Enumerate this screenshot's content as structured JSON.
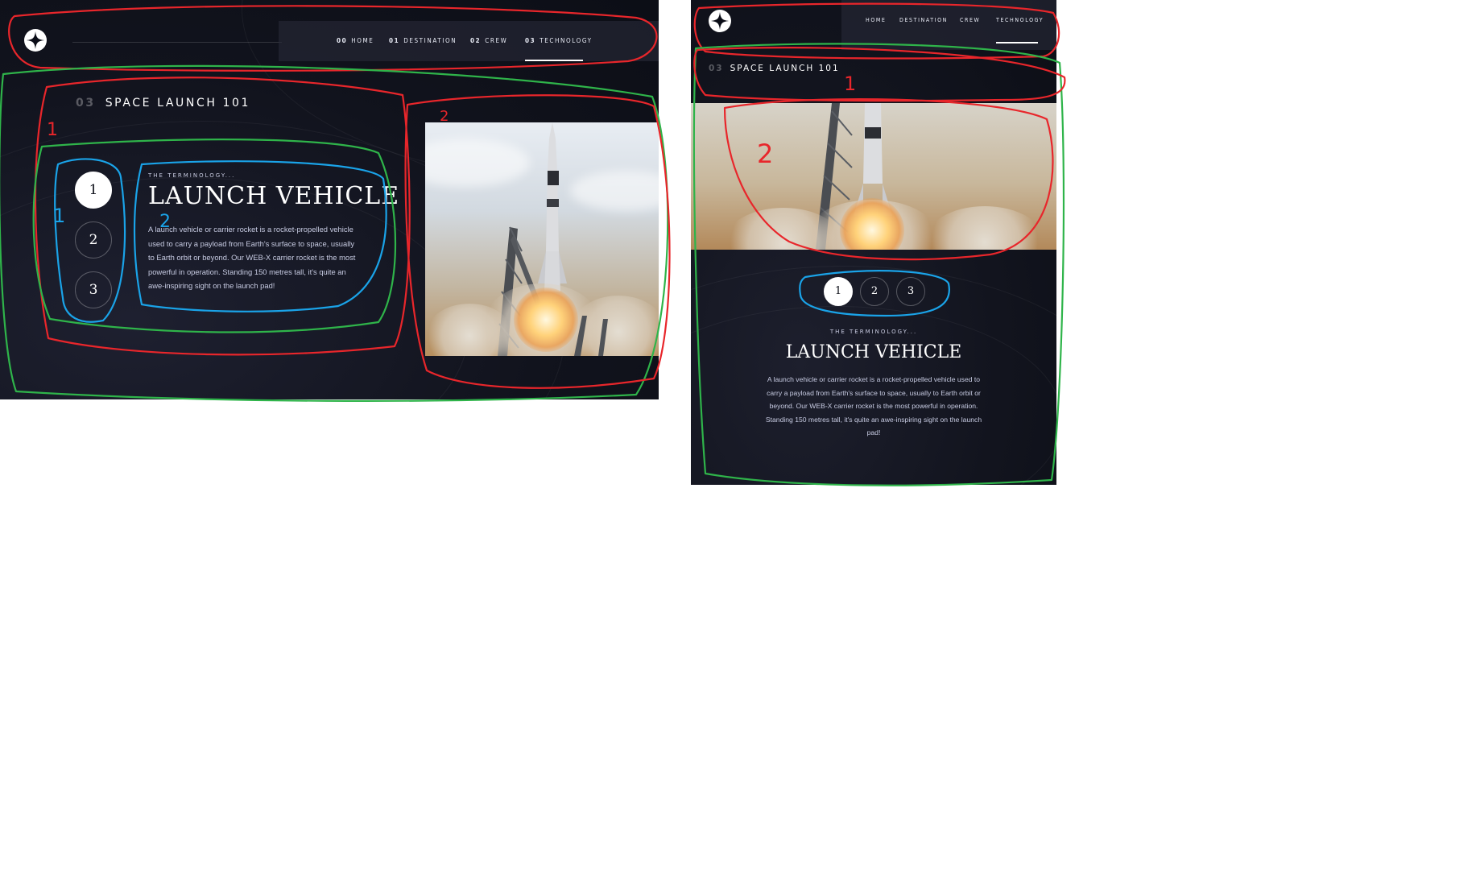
{
  "desktop": {
    "nav": [
      {
        "num": "00",
        "label": "HOME"
      },
      {
        "num": "01",
        "label": "DESTINATION"
      },
      {
        "num": "02",
        "label": "CREW"
      },
      {
        "num": "03",
        "label": "TECHNOLOGY"
      }
    ],
    "heading_num": "03",
    "heading": "SPACE LAUNCH 101",
    "slides": [
      "1",
      "2",
      "3"
    ],
    "active_slide": 1,
    "terminology": "THE TERMINOLOGY...",
    "title": "LAUNCH VEHICLE",
    "description": "A launch vehicle or carrier rocket is a rocket-propelled vehicle used to carry a payload from Earth's surface to space, usually to Earth orbit or beyond. Our WEB-X carrier rocket is the most powerful in operation. Standing 150 metres tall, it's quite an awe-inspiring sight on the launch pad!"
  },
  "tablet": {
    "nav": [
      "HOME",
      "DESTINATION",
      "CREW",
      "TECHNOLOGY"
    ],
    "heading_num": "03",
    "heading": "SPACE LAUNCH 101",
    "slides": [
      "1",
      "2",
      "3"
    ],
    "terminology": "THE TERMINOLOGY...",
    "title": "LAUNCH VEHICLE",
    "description": "A launch vehicle or carrier rocket is a rocket-propelled vehicle used to carry a payload from Earth's surface to space, usually to Earth orbit or beyond. Our WEB-X carrier rocket is the most powerful in operation. Standing 150 metres tall, it's quite an awe-inspiring sight on the launch pad!"
  },
  "annotations": {
    "red_1": "1",
    "red_2": "2",
    "blue_1": "1",
    "blue_2": "2",
    "tablet_red_1": "1",
    "tablet_red_2": "2"
  },
  "colors": {
    "background": "#0b0d17",
    "accent_white": "#ffffff",
    "text_muted": "#d0d6f9",
    "annotation_red": "#e8262b",
    "annotation_green": "#2fb44a",
    "annotation_blue": "#1aa3e8"
  }
}
